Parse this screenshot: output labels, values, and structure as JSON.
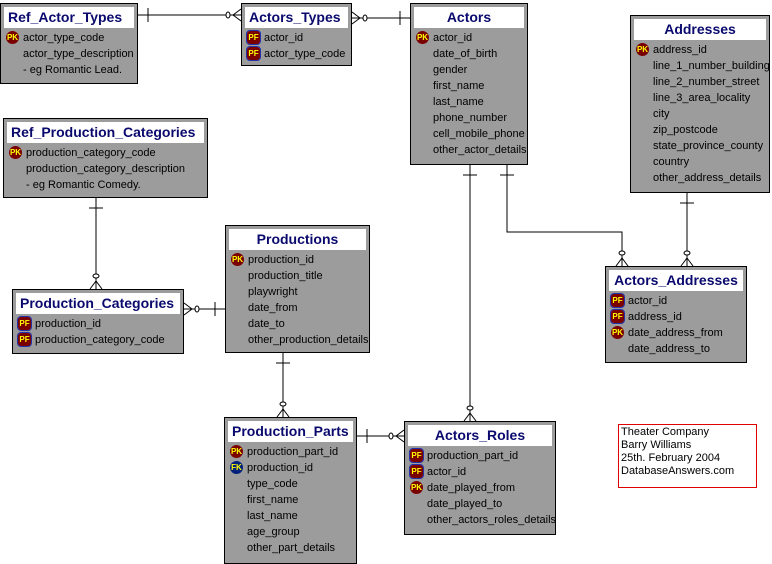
{
  "tables": [
    {
      "name": "Ref_Actor_Types",
      "columns": [
        {
          "key": "PK",
          "name": "actor_type_code"
        },
        {
          "key": "",
          "name": "actor_type_description"
        },
        {
          "key": "",
          "name": "- eg Romantic Lead."
        }
      ]
    },
    {
      "name": "Actors_Types",
      "columns": [
        {
          "key": "PF",
          "name": "actor_id"
        },
        {
          "key": "PF",
          "name": "actor_type_code"
        }
      ]
    },
    {
      "name": "Actors",
      "columns": [
        {
          "key": "PK",
          "name": "actor_id"
        },
        {
          "key": "",
          "name": "date_of_birth"
        },
        {
          "key": "",
          "name": "gender"
        },
        {
          "key": "",
          "name": "first_name"
        },
        {
          "key": "",
          "name": "last_name"
        },
        {
          "key": "",
          "name": "phone_number"
        },
        {
          "key": "",
          "name": "cell_mobile_phone"
        },
        {
          "key": "",
          "name": "other_actor_details"
        }
      ]
    },
    {
      "name": "Addresses",
      "columns": [
        {
          "key": "PK",
          "name": "address_id"
        },
        {
          "key": "",
          "name": "line_1_number_building"
        },
        {
          "key": "",
          "name": "line_2_number_street"
        },
        {
          "key": "",
          "name": "line_3_area_locality"
        },
        {
          "key": "",
          "name": "city"
        },
        {
          "key": "",
          "name": "zip_postcode"
        },
        {
          "key": "",
          "name": "state_province_county"
        },
        {
          "key": "",
          "name": "country"
        },
        {
          "key": "",
          "name": "other_address_details"
        }
      ]
    },
    {
      "name": "Ref_Production_Categories",
      "columns": [
        {
          "key": "PK",
          "name": "production_category_code"
        },
        {
          "key": "",
          "name": "production_category_description"
        },
        {
          "key": "",
          "name": "- eg Romantic Comedy."
        }
      ]
    },
    {
      "name": "Production_Categories",
      "columns": [
        {
          "key": "PF",
          "name": "production_id"
        },
        {
          "key": "PF",
          "name": "production_category_code"
        }
      ]
    },
    {
      "name": "Productions",
      "columns": [
        {
          "key": "PK",
          "name": "production_id"
        },
        {
          "key": "",
          "name": "production_title"
        },
        {
          "key": "",
          "name": "playwright"
        },
        {
          "key": "",
          "name": "date_from"
        },
        {
          "key": "",
          "name": "date_to"
        },
        {
          "key": "",
          "name": "other_production_details"
        }
      ]
    },
    {
      "name": "Actors_Addresses",
      "columns": [
        {
          "key": "PF",
          "name": "actor_id"
        },
        {
          "key": "PF",
          "name": "address_id"
        },
        {
          "key": "PK",
          "name": "date_address_from"
        },
        {
          "key": "",
          "name": "date_address_to"
        }
      ]
    },
    {
      "name": "Production_Parts",
      "columns": [
        {
          "key": "PK",
          "name": "production_part_id"
        },
        {
          "key": "FK",
          "name": "production_id"
        },
        {
          "key": "",
          "name": "type_code"
        },
        {
          "key": "",
          "name": "first_name"
        },
        {
          "key": "",
          "name": "last_name"
        },
        {
          "key": "",
          "name": "age_group"
        },
        {
          "key": "",
          "name": "other_part_details"
        }
      ]
    },
    {
      "name": "Actors_Roles",
      "columns": [
        {
          "key": "PF",
          "name": "production_part_id"
        },
        {
          "key": "PF",
          "name": "actor_id"
        },
        {
          "key": "PK",
          "name": "date_played_from"
        },
        {
          "key": "",
          "name": "date_played_to"
        },
        {
          "key": "",
          "name": "other_actors_roles_details"
        }
      ]
    }
  ],
  "note": {
    "lines": [
      "Theater Company",
      "Barry Williams",
      "25th. February 2004",
      "DatabaseAnswers.com"
    ]
  },
  "colors": {
    "table_bg": "#9c9c9c",
    "title_text": "#0a0a6e",
    "pk_icon": "#7a0000",
    "fk_icon": "#00207a",
    "note_border": "#e00000"
  }
}
